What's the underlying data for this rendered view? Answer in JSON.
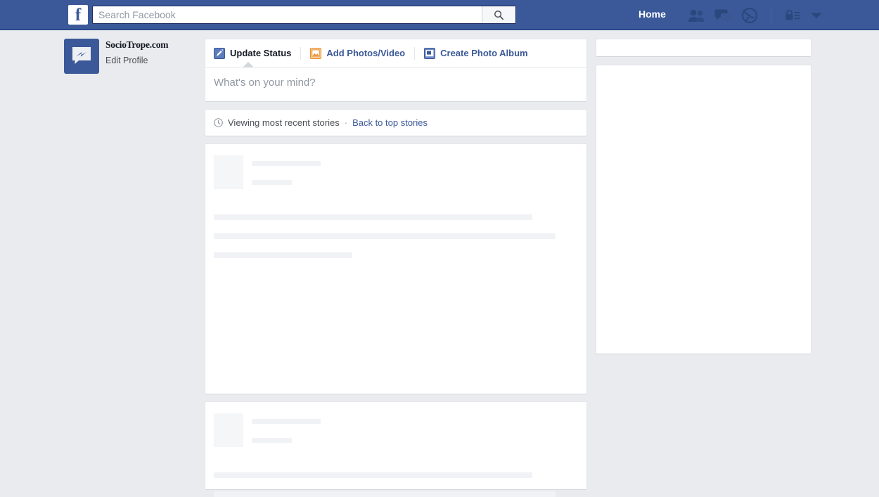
{
  "header": {
    "logo_letter": "f",
    "search": {
      "placeholder": "Search Facebook",
      "value": ""
    },
    "home_label": "Home",
    "icons": [
      {
        "name": "friend-requests-icon"
      },
      {
        "name": "messages-icon"
      },
      {
        "name": "notifications-globe-icon"
      },
      {
        "name": "privacy-lock-icon"
      },
      {
        "name": "account-chevron-down-icon"
      }
    ],
    "colors": {
      "bar": "#3b5998",
      "bar_border": "#133783"
    }
  },
  "profile": {
    "name": "SocioTrope.com",
    "edit_label": "Edit Profile",
    "avatar_icon": "messenger-bolt-icon"
  },
  "composer": {
    "tabs": [
      {
        "label": "Update Status",
        "icon": "pencil-icon",
        "active": true
      },
      {
        "label": "Add Photos/Video",
        "icon": "photo-icon",
        "active": false
      },
      {
        "label": "Create Photo Album",
        "icon": "album-icon",
        "active": false
      }
    ],
    "placeholder": "What's on your mind?"
  },
  "sortbar": {
    "icon": "clock-icon",
    "text": "Viewing most recent stories",
    "separator": "·",
    "link": "Back to top stories"
  },
  "feed": {
    "posts": [
      {
        "state": "loading"
      },
      {
        "state": "loading"
      }
    ]
  },
  "sidebar": {
    "cards": [
      {
        "state": "empty"
      },
      {
        "state": "empty"
      }
    ]
  },
  "colors": {
    "page_background": "#e9ebee",
    "link": "#3b5998",
    "text_primary": "#141823",
    "text_secondary": "#4b4f56",
    "placeholder": "#9197a3",
    "skeleton": "#f0f2f5"
  }
}
